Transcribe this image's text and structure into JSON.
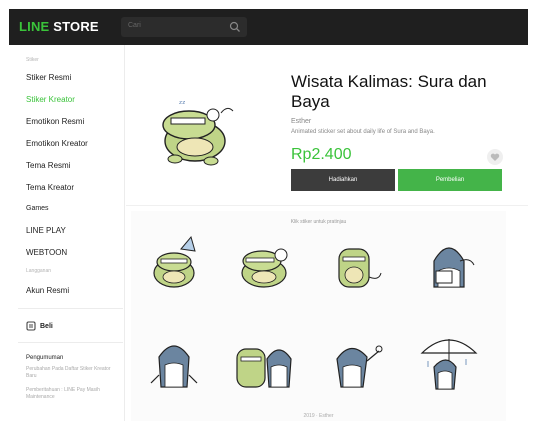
{
  "header": {
    "logo_line": "LINE",
    "logo_store": "STORE",
    "search_placeholder": "Cari",
    "search_icon": "search-icon"
  },
  "sidebar": {
    "group_stiker": "Stiker",
    "items_top": [
      {
        "label": "Stiker Resmi"
      },
      {
        "label": "Stiker Kreator"
      },
      {
        "label": "Emotikon Resmi"
      },
      {
        "label": "Emotikon Kreator"
      },
      {
        "label": "Tema Resmi"
      },
      {
        "label": "Tema Kreator"
      },
      {
        "label": "Games"
      },
      {
        "label": "LINE PLAY"
      },
      {
        "label": "WEBTOON"
      }
    ],
    "group_langganan": "Langganan",
    "akun_resmi": "Akun Resmi",
    "beli_label": "Beli",
    "beli_icon": "coin-icon",
    "announcement_title": "Pengumuman",
    "announcement_1": "Perubahan Pada Daftar Stiker Kreator Baru",
    "announcement_2": "Pemberitahuan : LINE Pay Masih Maintenance"
  },
  "product": {
    "title": "Wisata Kalimas: Sura dan Baya",
    "author": "Esther",
    "description": "Animated sticker set about daily life of Sura and Baya.",
    "price": "Rp2.400",
    "favorite_icon": "heart-icon",
    "gift_button": "Hadiahkan",
    "buy_button": "Pembelian"
  },
  "preview": {
    "caption": "Klik stiker untuk pratinjau",
    "stickers": [
      {
        "name": "croc-party-hat"
      },
      {
        "name": "croc-sleeping"
      },
      {
        "name": "croc-standing"
      },
      {
        "name": "shark-with-card"
      },
      {
        "name": "shark-standing"
      },
      {
        "name": "croc-and-shark"
      },
      {
        "name": "shark-pointing"
      },
      {
        "name": "shark-umbrella"
      }
    ],
    "copyright": "2019 · Esther"
  },
  "colors": {
    "brand_green": "#3ac33a",
    "topbar": "#1f1f1f",
    "gift_button": "#3c3c3c",
    "buy_button": "#44b449"
  }
}
